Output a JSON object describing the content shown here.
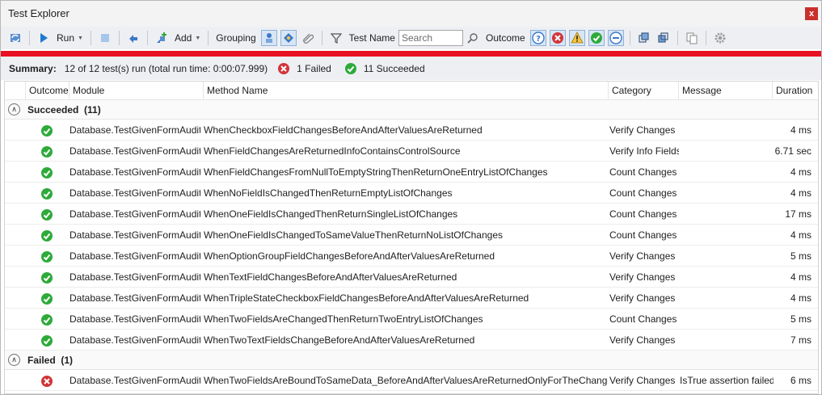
{
  "window": {
    "title": "Test Explorer",
    "close_label": "x"
  },
  "toolbar": {
    "run_label": "Run",
    "add_label": "Add",
    "grouping_label": "Grouping",
    "test_name_label": "Test Name",
    "search_placeholder": "Search",
    "outcome_label": "Outcome"
  },
  "summary": {
    "label": "Summary:",
    "text": "12 of 12 test(s) run (total run time: 0:00:07.999)",
    "failed_text": "1 Failed",
    "succeeded_text": "11 Succeeded"
  },
  "columns": {
    "outcome": "Outcome",
    "module": "Module",
    "method": "Method Name",
    "category": "Category",
    "message": "Message",
    "duration": "Duration"
  },
  "groups": {
    "succeeded": {
      "label": "Succeeded",
      "count": "(11)",
      "rows": [
        {
          "module": "Database.TestGivenFormAuditor",
          "method": "WhenCheckboxFieldChangesBeforeAndAfterValuesAreReturned",
          "category": "Verify Changes",
          "message": "",
          "duration": "4 ms"
        },
        {
          "module": "Database.TestGivenFormAuditor",
          "method": "WhenFieldChangesAreReturnedInfoContainsControlSource",
          "category": "Verify Info Fields",
          "message": "",
          "duration": "6.71 sec"
        },
        {
          "module": "Database.TestGivenFormAuditor",
          "method": "WhenFieldChangesFromNullToEmptyStringThenReturnOneEntryListOfChanges",
          "category": "Count Changes",
          "message": "",
          "duration": "4 ms"
        },
        {
          "module": "Database.TestGivenFormAuditor",
          "method": "WhenNoFieldIsChangedThenReturnEmptyListOfChanges",
          "category": "Count Changes",
          "message": "",
          "duration": "4 ms"
        },
        {
          "module": "Database.TestGivenFormAuditor",
          "method": "WhenOneFieldIsChangedThenReturnSingleListOfChanges",
          "category": "Count Changes",
          "message": "",
          "duration": "17 ms"
        },
        {
          "module": "Database.TestGivenFormAuditor",
          "method": "WhenOneFieldIsChangedToSameValueThenReturnNoListOfChanges",
          "category": "Count Changes",
          "message": "",
          "duration": "4 ms"
        },
        {
          "module": "Database.TestGivenFormAuditor",
          "method": "WhenOptionGroupFieldChangesBeforeAndAfterValuesAreReturned",
          "category": "Verify Changes",
          "message": "",
          "duration": "5 ms"
        },
        {
          "module": "Database.TestGivenFormAuditor",
          "method": "WhenTextFieldChangesBeforeAndAfterValuesAreReturned",
          "category": "Verify Changes",
          "message": "",
          "duration": "4 ms"
        },
        {
          "module": "Database.TestGivenFormAuditor",
          "method": "WhenTripleStateCheckboxFieldChangesBeforeAndAfterValuesAreReturned",
          "category": "Verify Changes",
          "message": "",
          "duration": "4 ms"
        },
        {
          "module": "Database.TestGivenFormAuditor",
          "method": "WhenTwoFieldsAreChangedThenReturnTwoEntryListOfChanges",
          "category": "Count Changes",
          "message": "",
          "duration": "5 ms"
        },
        {
          "module": "Database.TestGivenFormAuditor",
          "method": "WhenTwoTextFieldsChangeBeforeAndAfterValuesAreReturned",
          "category": "Verify Changes",
          "message": "",
          "duration": "7 ms"
        }
      ]
    },
    "failed": {
      "label": "Failed",
      "count": "(1)",
      "rows": [
        {
          "module": "Database.TestGivenFormAuditor",
          "method": "WhenTwoFieldsAreBoundToSameData_BeforeAndAfterValuesAreReturnedOnlyForTheChangedField",
          "category": "Verify Changes",
          "message": "IsTrue assertion failed.",
          "duration": "6 ms"
        }
      ]
    }
  },
  "colors": {
    "pass": "#2eaa3a",
    "fail": "#d13438",
    "failbar": "#e81123",
    "accent": "#1e7ad1"
  }
}
